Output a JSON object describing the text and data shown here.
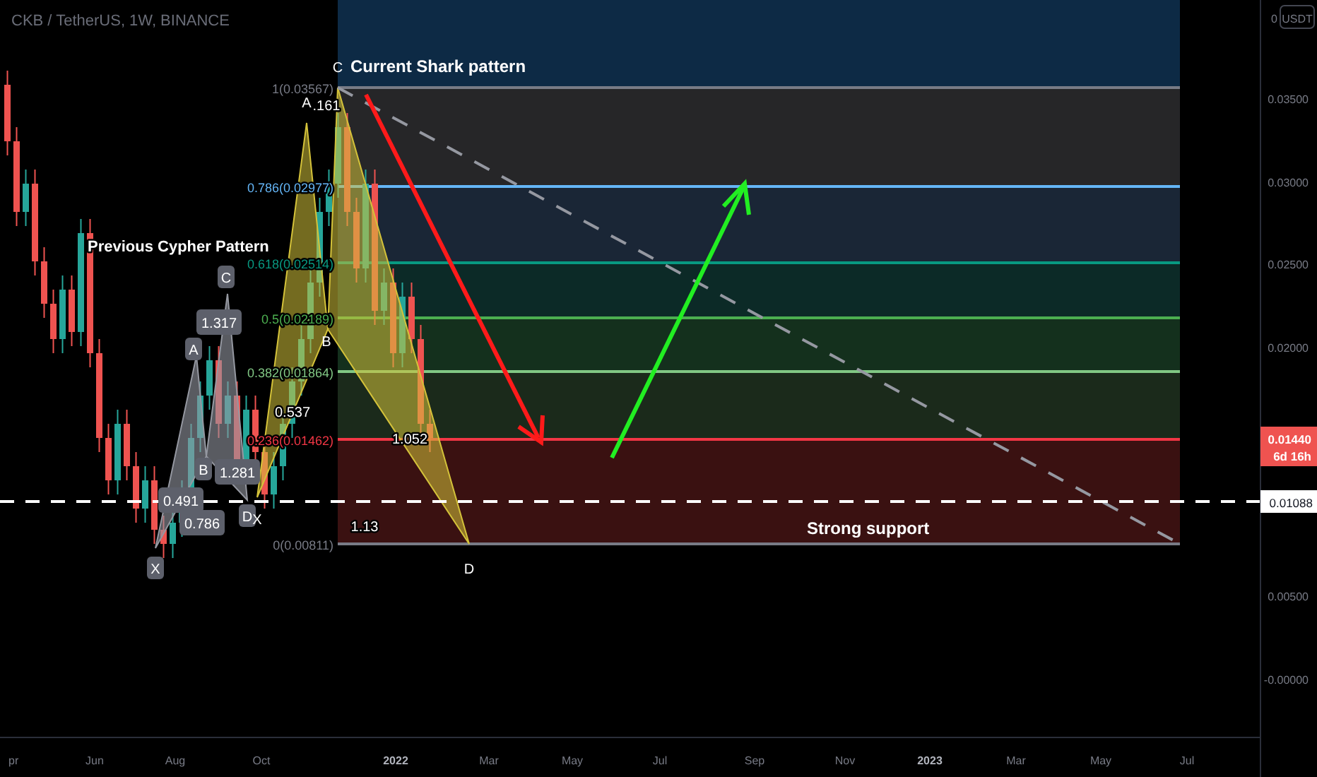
{
  "header": {
    "title": "CKB / TetherUS, 1W, BINANCE"
  },
  "shark_pattern": {
    "title": "Current Shark pattern",
    "points": [
      "X",
      "A",
      "B",
      "C",
      "D"
    ],
    "ratios": [
      ".161",
      "0.537",
      "1.052",
      "1.13"
    ]
  },
  "cypher_pattern": {
    "title": "Previous Cypher Pattern",
    "points": [
      "X",
      "A",
      "B",
      "C",
      "D"
    ],
    "ratios": [
      "1.317",
      "0.491",
      "0.786",
      "1.281"
    ]
  },
  "fib_levels": [
    {
      "label": "1(0.03567)",
      "color": "#787b86"
    },
    {
      "label": "0.786(0.02977)",
      "color": "#64b5f6"
    },
    {
      "label": "0.618(0.02514)",
      "color": "#089981"
    },
    {
      "label": "0.5(0.02189)",
      "color": "#4caf50"
    },
    {
      "label": "0.382(0.01864)",
      "color": "#81c784"
    },
    {
      "label": "0.236(0.01462)",
      "color": "#f23645"
    },
    {
      "label": "0(0.00811)",
      "color": "#787b86"
    }
  ],
  "support_label": "Strong support",
  "price_axis": {
    "currency": "USDT",
    "labels": [
      "0",
      "0.03500",
      "0.03000",
      "0.02500",
      "0.02000",
      "0.00500",
      "-0.00000"
    ],
    "last_price": "0.01440",
    "countdown": "6d 16h",
    "line_price": "0.01088"
  },
  "time_axis": [
    {
      "label": "pr",
      "kind": "month"
    },
    {
      "label": "Jun",
      "kind": "month"
    },
    {
      "label": "Aug",
      "kind": "month"
    },
    {
      "label": "Oct",
      "kind": "month"
    },
    {
      "label": "2022",
      "kind": "year"
    },
    {
      "label": "Mar",
      "kind": "month"
    },
    {
      "label": "May",
      "kind": "month"
    },
    {
      "label": "Jul",
      "kind": "month"
    },
    {
      "label": "Sep",
      "kind": "month"
    },
    {
      "label": "Nov",
      "kind": "month"
    },
    {
      "label": "2023",
      "kind": "year"
    },
    {
      "label": "Mar",
      "kind": "month"
    },
    {
      "label": "May",
      "kind": "month"
    },
    {
      "label": "Jul",
      "kind": "month"
    }
  ]
}
